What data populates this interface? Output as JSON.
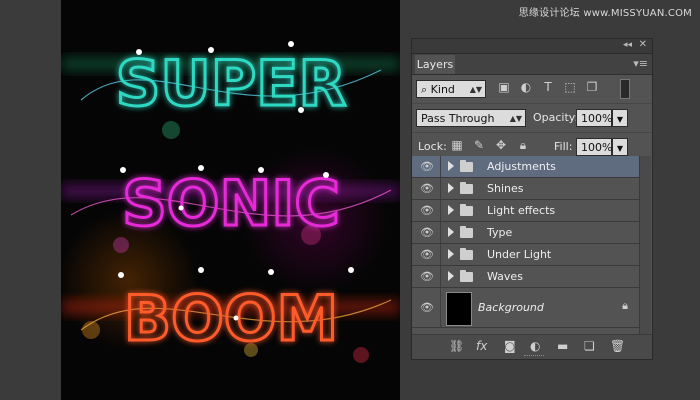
{
  "watermark": "思缘设计论坛 www.MISSYUAN.COM",
  "artwork": {
    "lines": [
      "SUPER",
      "SONIC",
      "BOOM"
    ],
    "colors": [
      "#2fd9c4",
      "#e62ad8",
      "#ff5a2a"
    ]
  },
  "panel": {
    "tab_label": "Layers",
    "filter_label": "Kind",
    "blend_mode": "Pass Through",
    "opacity_label": "Opacity:",
    "opacity_value": "100%",
    "lock_label": "Lock:",
    "fill_label": "Fill:",
    "fill_value": "100%",
    "layers": [
      {
        "name": "Adjustments",
        "selected": true
      },
      {
        "name": "Shines",
        "selected": false
      },
      {
        "name": "Light effects",
        "selected": false
      },
      {
        "name": "Type",
        "selected": false
      },
      {
        "name": "Under Light",
        "selected": false
      },
      {
        "name": "Waves",
        "selected": false
      }
    ],
    "background_layer": "Background"
  },
  "icons": {
    "search": "search-icon",
    "eye": "eye-icon",
    "lock": "lock-icon",
    "folder": "folder-icon"
  }
}
